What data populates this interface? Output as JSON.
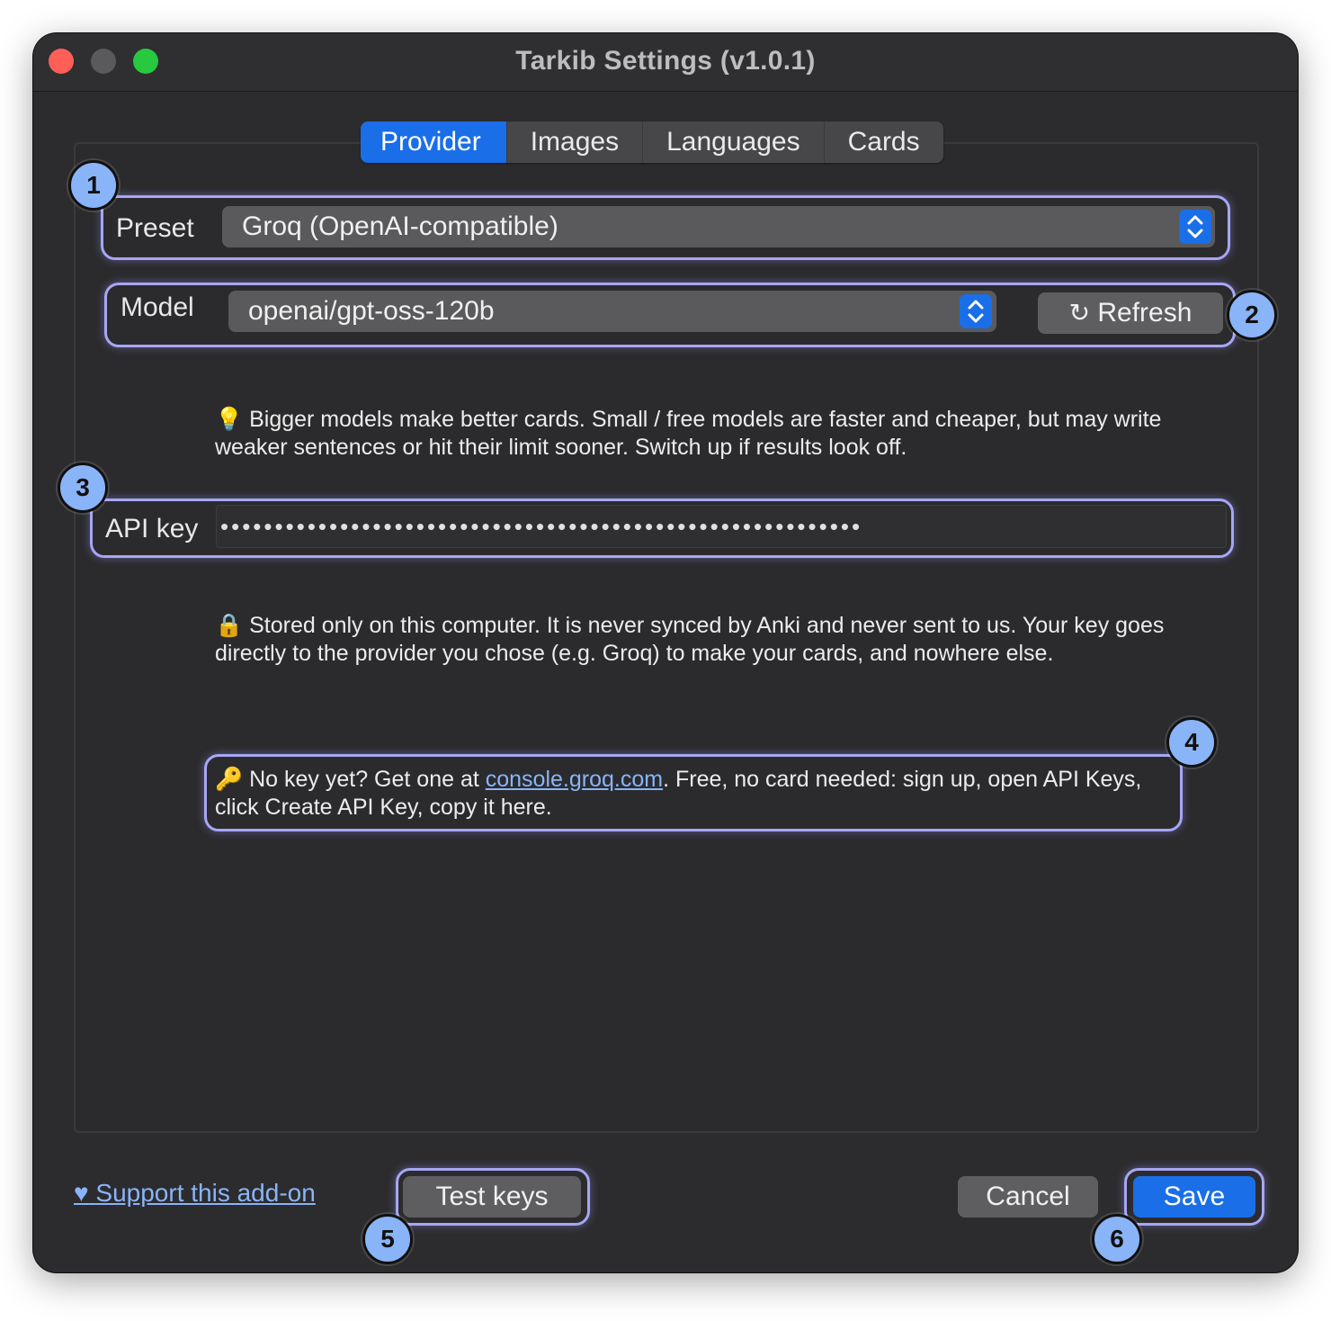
{
  "window": {
    "title": "Tarkib Settings (v1.0.1)"
  },
  "tabs": [
    {
      "label": "Provider",
      "active": true
    },
    {
      "label": "Images"
    },
    {
      "label": "Languages"
    },
    {
      "label": "Cards"
    }
  ],
  "provider": {
    "preset_label": "Preset",
    "preset_value": "Groq (OpenAI-compatible)",
    "model_label": "Model",
    "model_value": "openai/gpt-oss-120b",
    "refresh_label": "Refresh",
    "model_tip": "Bigger models make better cards. Small / free models are faster and cheaper, but may write weaker sentences or hit their limit sooner. Switch up if results look off.",
    "api_key_label": "API key",
    "api_key_value": "•••••••••••••••••••••••••••••••••••••••••••••••••••••••••••",
    "storage_note": "Stored only on this computer. It is never synced by Anki and never sent to us. Your key goes directly to the provider you chose (e.g. Groq) to make your cards, and nowhere else.",
    "key_hint_prefix": "No key yet? Get one at ",
    "key_hint_link": "console.groq.com",
    "key_hint_suffix": ". Free, no card needed: sign up, open API Keys, click Create API Key, copy it here."
  },
  "footer": {
    "support_label": "Support this add-on",
    "test_keys_label": "Test keys",
    "cancel_label": "Cancel",
    "save_label": "Save"
  },
  "annotations": [
    "1",
    "2",
    "3",
    "4",
    "5",
    "6"
  ],
  "colors": {
    "accent": "#1a6fe8",
    "highlight": "#a7a6f5",
    "badge": "#8ab4f8",
    "link": "#8ab4f8"
  },
  "icons": {
    "tip": "lightbulb-icon",
    "storage": "lock-icon",
    "hint": "key-icon",
    "support": "heart-icon",
    "refresh": "refresh-icon"
  }
}
